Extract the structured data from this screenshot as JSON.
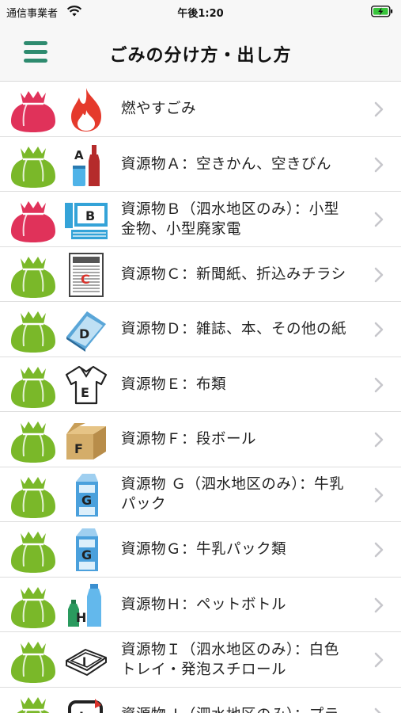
{
  "status_bar": {
    "carrier": "通信事業者",
    "time": "午後1:20",
    "icons": [
      "wifi-icon",
      "battery-charging-icon"
    ]
  },
  "nav": {
    "title": "ごみの分け方・出し方",
    "menu_icon": "hamburger-menu-icon"
  },
  "colors": {
    "accent": "#2e8b6f",
    "bag_burnable": "#e0325a",
    "bag_resource": "#7ab829",
    "chevron": "#c7c7cc"
  },
  "items": [
    {
      "label": "燃やすごみ",
      "bag": "red",
      "icon": "fire-icon"
    },
    {
      "label": "資源物Ａ：空きかん、空きびん",
      "bag": "green",
      "icon": "can-bottle-icon",
      "icon_letter": "A"
    },
    {
      "label": "資源物Ｂ（泗水地区のみ）：小型\n金物、小型廃家電",
      "bag": "red",
      "icon": "computer-icon",
      "icon_letter": "B"
    },
    {
      "label": "資源物Ｃ：新聞紙、折込みチラシ",
      "bag": "green",
      "icon": "newspaper-icon",
      "icon_letter": "C"
    },
    {
      "label": "資源物Ｄ：雑誌、本、その他の紙",
      "bag": "green",
      "icon": "magazine-icon",
      "icon_letter": "D"
    },
    {
      "label": "資源物Ｅ：布類",
      "bag": "green",
      "icon": "shirt-icon",
      "icon_letter": "E"
    },
    {
      "label": "資源物Ｆ：段ボール",
      "bag": "green",
      "icon": "cardboard-box-icon",
      "icon_letter": "F"
    },
    {
      "label": "資源物 Ｇ（泗水地区のみ）：牛乳\nパック",
      "bag": "green",
      "icon": "milk-carton-icon",
      "icon_letter": "G"
    },
    {
      "label": "資源物Ｇ：牛乳パック類",
      "bag": "green",
      "icon": "milk-carton-icon",
      "icon_letter": "G"
    },
    {
      "label": "資源物Ｈ：ペットボトル",
      "bag": "green",
      "icon": "pet-bottle-icon",
      "icon_letter": "H"
    },
    {
      "label": "資源物Ｉ（泗水地区のみ）：白色\nトレイ・発泡スチロール",
      "bag": "green",
      "icon": "foam-tray-icon",
      "icon_letter": "I"
    },
    {
      "label": "資源物Ｊ（泗水地区のみ）：プラ",
      "bag": "green",
      "icon": "plastic-icon",
      "icon_letter": "J"
    }
  ]
}
